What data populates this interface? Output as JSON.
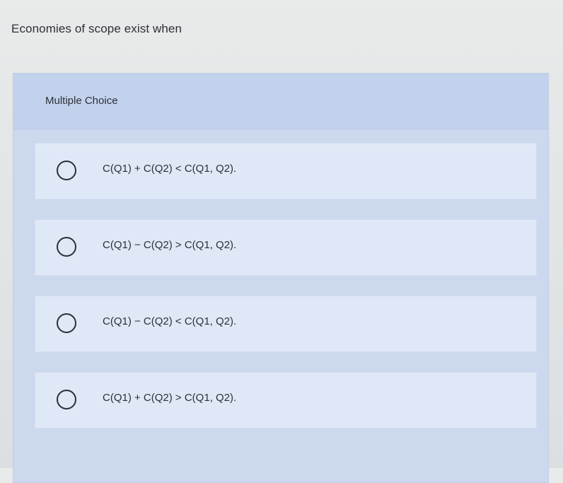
{
  "question": {
    "text": "Economies of scope exist when"
  },
  "panel": {
    "title": "Multiple Choice"
  },
  "options": [
    {
      "label": "C(Q1) + C(Q2) < C(Q1, Q2)."
    },
    {
      "label": "C(Q1) − C(Q2) > C(Q1, Q2)."
    },
    {
      "label": "C(Q1) − C(Q2) < C(Q1, Q2)."
    },
    {
      "label": "C(Q1) + C(Q2) > C(Q1, Q2)."
    }
  ],
  "colors": {
    "page_background": "#e5e7e8",
    "panel_background": "#cbd8ee",
    "option_background": "#dfe8f6",
    "text": "#2c2f38"
  }
}
